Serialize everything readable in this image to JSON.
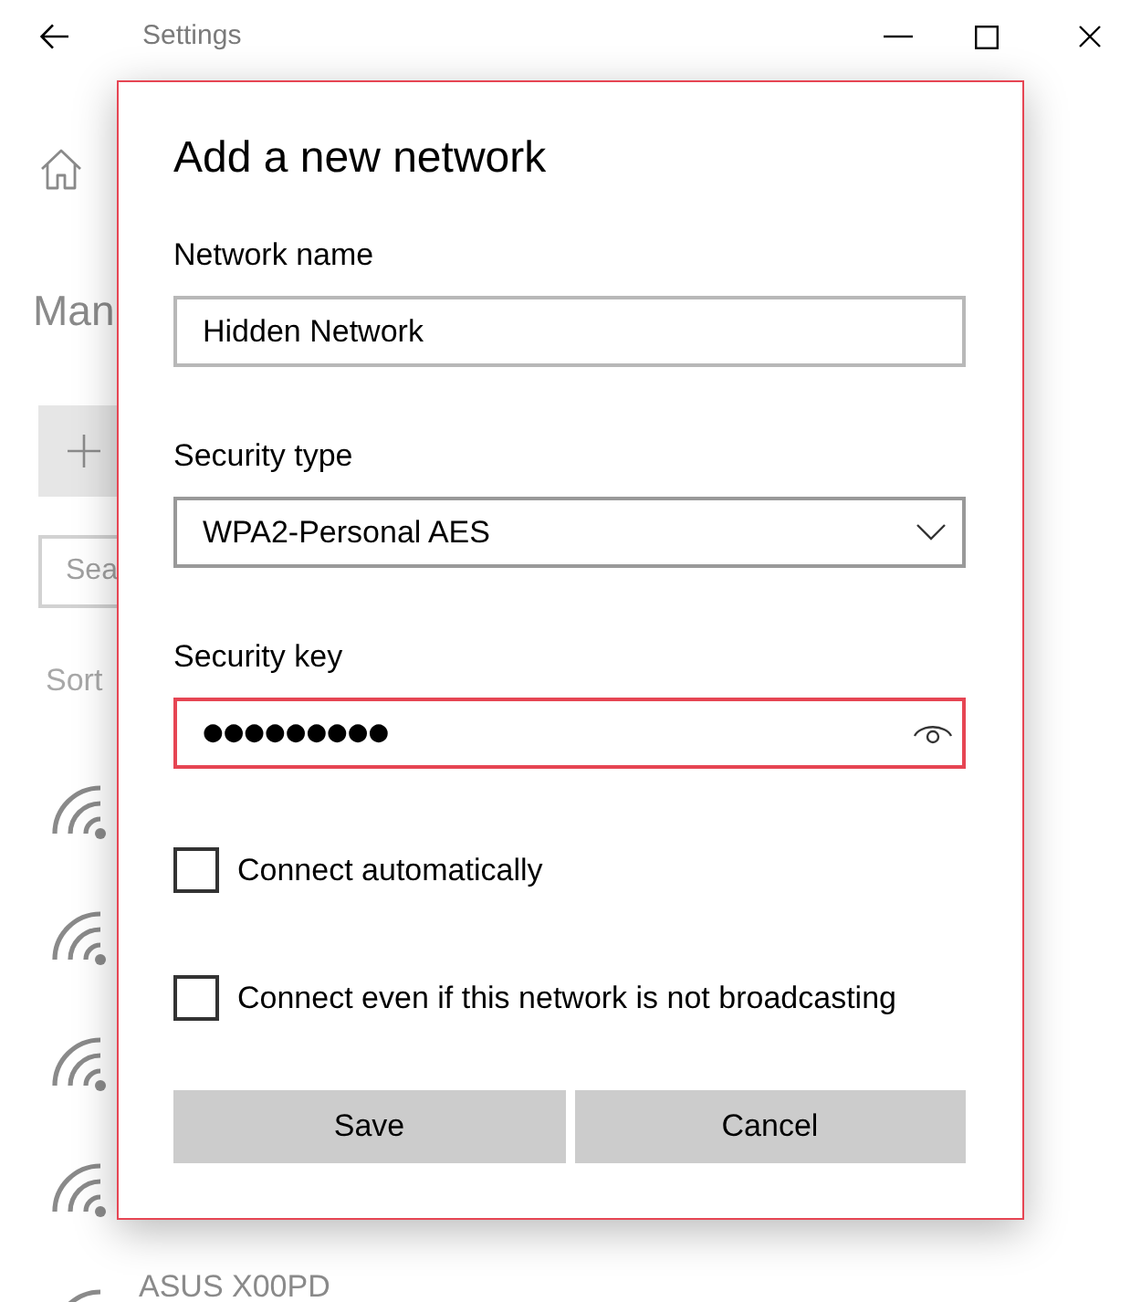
{
  "window": {
    "title": "Settings"
  },
  "page": {
    "heading": "Man",
    "search": {
      "placeholder": "Sea"
    },
    "sort_label": "Sort",
    "networks": [
      {
        "kind": "wifi"
      },
      {
        "kind": "wifi"
      },
      {
        "kind": "wifi"
      },
      {
        "kind": "wifi"
      },
      {
        "kind": "wifi",
        "name": "ASUS X00PD"
      }
    ]
  },
  "dialog": {
    "title": "Add a new network",
    "fields": [
      {
        "kind": "text",
        "label": "Network name",
        "value": "Hidden Network",
        "focused": false
      },
      {
        "kind": "dropdown",
        "label": "Security type",
        "value": "WPA2-Personal AES",
        "focused": false
      },
      {
        "kind": "password",
        "label": "Security key",
        "value": "●●●●●●●●●",
        "focused": true
      }
    ],
    "checkboxes": [
      {
        "label": "Connect automatically",
        "checked": false
      },
      {
        "label": "Connect even if this network is not broadcasting",
        "checked": false
      }
    ],
    "buttons": [
      "Save",
      "Cancel"
    ]
  }
}
